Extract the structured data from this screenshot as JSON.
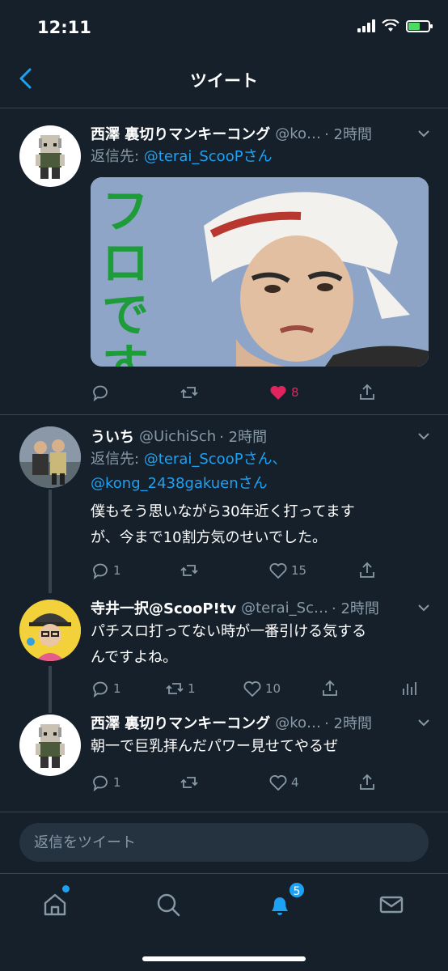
{
  "status": {
    "time": "12:11"
  },
  "nav": {
    "title": "ツイート"
  },
  "tweets": [
    {
      "name": "西澤 裏切りマンキーコング",
      "handle": "@ko…",
      "time": "· 2時間",
      "reply_prefix": "返信先: ",
      "reply_to": "@terai_ScooPさん",
      "image_text": "フロですか",
      "likes": "8",
      "like_color": "#e0245e"
    },
    {
      "name": "ういち",
      "handle": "@UichiSch",
      "time": "· 2時間",
      "reply_prefix": "返信先: ",
      "reply_to": "@terai_ScooPさん、",
      "reply_to_2": "@kong_2438gakuenさん",
      "text_line1": "僕もそう思いながら30年近く打ってます",
      "text_line2": "が、今まで10割方気のせいでした。",
      "replies": "1",
      "likes": "15"
    },
    {
      "name": "寺井一択@ScooP!tv",
      "handle": "@terai_Sc…",
      "time": "· 2時間",
      "text_line1": "パチスロ打ってない時が一番引ける気する",
      "text_line2": "んですよね。",
      "replies": "1",
      "retweets": "1",
      "likes": "10"
    },
    {
      "name": "西澤 裏切りマンキーコング",
      "handle": "@ko…",
      "time": "· 2時間",
      "text_line1": "朝一で巨乳拝んだパワー見せてやるぜ",
      "replies": "1",
      "likes": "4"
    }
  ],
  "reply_box": {
    "placeholder": "返信をツイート"
  },
  "tabs": {
    "notifications_badge": "5"
  },
  "colors": {
    "background": "#15202b",
    "accent": "#1da1f2",
    "muted": "#8899a6",
    "like": "#e0245e"
  }
}
